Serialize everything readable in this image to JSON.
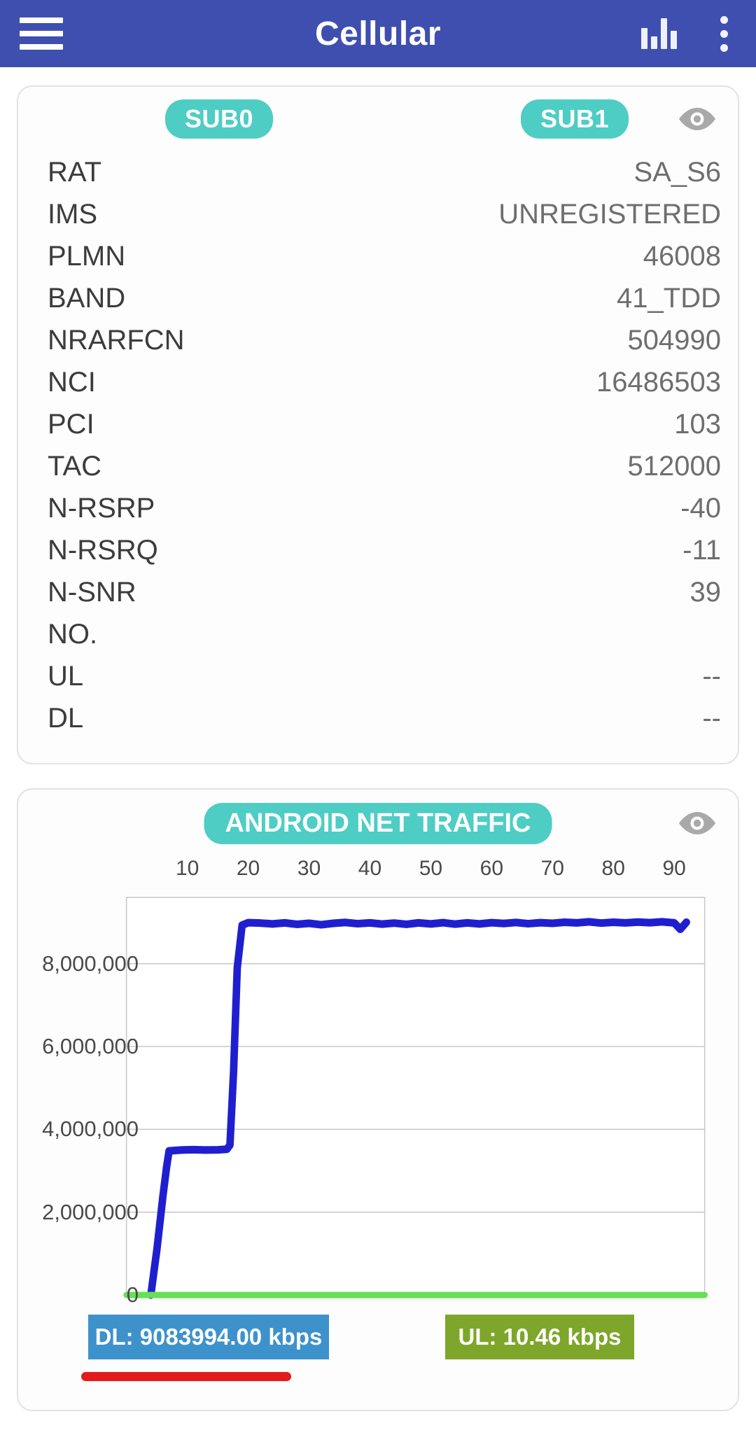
{
  "appbar": {
    "title": "Cellular",
    "menu_icon": "hamburger-icon",
    "stats_icon": "bar-chart-icon",
    "overflow_icon": "three-dots-icon"
  },
  "sim_card": {
    "sub0_label": "SUB0",
    "sub1_label": "SUB1",
    "visibility_icon": "eye-icon",
    "rows": [
      {
        "label": "RAT",
        "value": "SA_S6"
      },
      {
        "label": "IMS",
        "value": "UNREGISTERED"
      },
      {
        "label": "PLMN",
        "value": "46008"
      },
      {
        "label": "BAND",
        "value": "41_TDD"
      },
      {
        "label": "NRARFCN",
        "value": "504990"
      },
      {
        "label": "NCI",
        "value": "16486503"
      },
      {
        "label": "PCI",
        "value": "103"
      },
      {
        "label": "TAC",
        "value": "512000"
      },
      {
        "label": "N-RSRP",
        "value": "-40"
      },
      {
        "label": "N-RSRQ",
        "value": "-11"
      },
      {
        "label": "N-SNR",
        "value": "39"
      },
      {
        "label": "NO.",
        "value": ""
      },
      {
        "label": "UL",
        "value": "--"
      },
      {
        "label": "DL",
        "value": "--"
      }
    ]
  },
  "traffic_card": {
    "title": "ANDROID NET TRAFFIC",
    "visibility_icon": "eye-icon",
    "dl_badge": "DL: 9083994.00 kbps",
    "ul_badge": "UL: 10.46 kbps",
    "dl_color": "#3d92cc",
    "ul_color": "#7ea62a",
    "underline_color": "#e21b1b"
  },
  "colors": {
    "appbar": "#3f4fb0",
    "accent_teal": "#4ecdc4",
    "dl_line": "#1f1fd0",
    "ul_line": "#66e055"
  },
  "chart_data": {
    "type": "line",
    "title": "ANDROID NET TRAFFIC",
    "xlabel": "",
    "ylabel": "",
    "grid": true,
    "legend_position": "bottom",
    "xlim": [
      0,
      95
    ],
    "ylim": [
      0,
      9600000
    ],
    "xticks": [
      10,
      20,
      30,
      40,
      50,
      60,
      70,
      80,
      90
    ],
    "yticks": [
      0,
      2000000,
      4000000,
      6000000,
      8000000
    ],
    "ytick_labels": [
      "0",
      "2,000,000",
      "4,000,000",
      "6,000,000",
      "8,000,000"
    ],
    "series": [
      {
        "name": "DL",
        "color": "#1f1fd0",
        "x": [
          4,
          5,
          6,
          6.6,
          7,
          9,
          11,
          13,
          15,
          16.5,
          17,
          17.6,
          18.2,
          19,
          20,
          22,
          24,
          26,
          28,
          30,
          32,
          34,
          36,
          38,
          40,
          42,
          44,
          46,
          48,
          50,
          52,
          54,
          56,
          58,
          60,
          62,
          64,
          66,
          68,
          70,
          72,
          74,
          76,
          78,
          80,
          82,
          84,
          86,
          88,
          90,
          91,
          92
        ],
        "y": [
          0,
          1100000,
          2400000,
          3100000,
          3480000,
          3500000,
          3510000,
          3500000,
          3505000,
          3520000,
          3620000,
          5400000,
          7900000,
          8930000,
          8990000,
          8980000,
          8960000,
          8985000,
          8950000,
          8975000,
          8940000,
          8975000,
          8995000,
          8965000,
          8985000,
          8955000,
          8980000,
          8950000,
          8985000,
          8960000,
          8990000,
          8955000,
          8985000,
          8960000,
          8990000,
          8970000,
          8995000,
          8965000,
          8990000,
          8975000,
          9000000,
          8985000,
          9010000,
          8980000,
          9000000,
          8985000,
          9005000,
          8990000,
          9010000,
          8985000,
          8830000,
          9000000
        ]
      },
      {
        "name": "UL",
        "color": "#66e055",
        "x": [
          0,
          95
        ],
        "y": [
          0,
          0
        ]
      }
    ]
  }
}
